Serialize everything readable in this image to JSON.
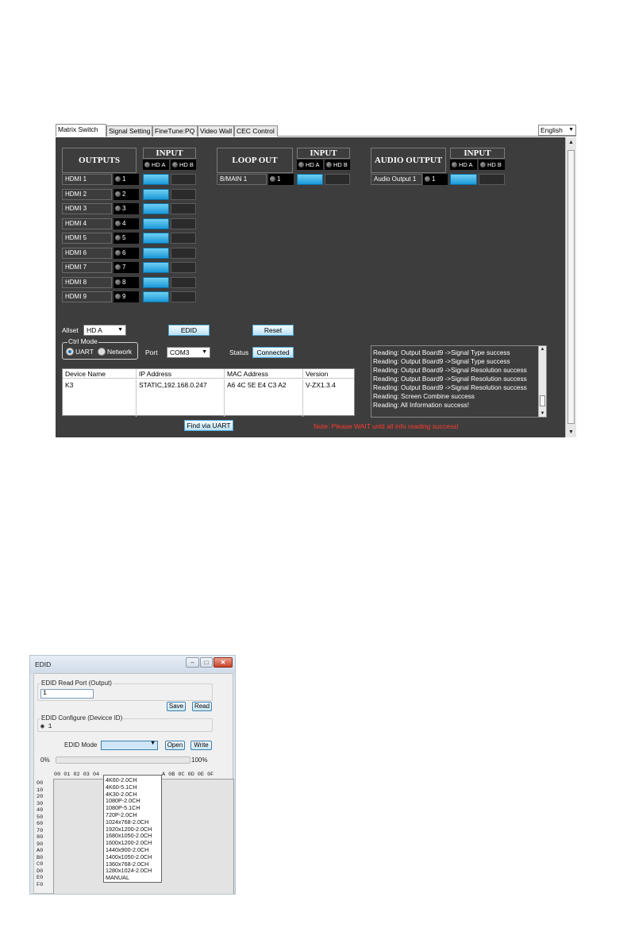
{
  "matrix": {
    "tabs": [
      "Matrix Switch",
      "Signal Setting",
      "FineTune:PQ",
      "Video Wall",
      "CEC Control"
    ],
    "language": "English",
    "outputs_title": "OUTPUTS",
    "input_title": "INPUT",
    "hd_a": "HD A",
    "hd_b": "HD B",
    "loop_out_title": "LOOP OUT",
    "audio_output_title": "AUDIO OUTPUT",
    "outputs": [
      {
        "label": "HDMI 1",
        "num": "1",
        "selected": "HD A"
      },
      {
        "label": "HDMI 2",
        "num": "2",
        "selected": "HD A"
      },
      {
        "label": "HDMI 3",
        "num": "3",
        "selected": "HD A"
      },
      {
        "label": "HDMI 4",
        "num": "4",
        "selected": "HD A"
      },
      {
        "label": "HDMI 5",
        "num": "5",
        "selected": "HD A"
      },
      {
        "label": "HDMI 6",
        "num": "6",
        "selected": "HD A"
      },
      {
        "label": "HDMI 7",
        "num": "7",
        "selected": "HD A"
      },
      {
        "label": "HDMI 8",
        "num": "8",
        "selected": "HD A"
      },
      {
        "label": "HDMI 9",
        "num": "9",
        "selected": "HD A"
      }
    ],
    "loop_out": {
      "label": "B/MAIN 1",
      "num": "1",
      "selected": "HD A"
    },
    "audio_output": {
      "label": "Audio Output 1",
      "num": "1",
      "selected": "HD A"
    },
    "allset_label": "Allset",
    "allset_value": "HD A",
    "edid_button": "EDID",
    "reset_button": "Reset",
    "ctrl_mode_label": "Ctrl Mode",
    "uart_label": "UART",
    "network_label": "Network",
    "port_label": "Port",
    "port_value": "COM3",
    "status_label": "Status",
    "status_value": "Connected",
    "table": {
      "headers": [
        "Device Name",
        "IP Address",
        "MAC Address",
        "Version"
      ],
      "rows": [
        [
          "K3",
          "STATIC,192.168.0.247",
          "A6 4C 5E E4 C3 A2",
          "V-ZX1.3.4"
        ]
      ]
    },
    "log_lines": [
      "Reading: Output Board9 ->Signal Type success",
      "Reading: Output Board9 ->Signal Type success",
      "Reading: Output Board9 ->Signal Resolution success",
      "Reading: Output Board9 ->Signal Resolution success",
      "Reading: Output Board9 ->Signal Resolution success",
      "Reading: Screen Combine success",
      "Reading: All Information success!"
    ],
    "find_button": "Find via UART",
    "note": "Note: Please WAIT until all info reading success!"
  },
  "edid": {
    "title": "EDID",
    "read_port_title": "EDID Read Port (Output)",
    "read_port_value": "1",
    "save_button": "Save",
    "read_button": "Read",
    "configure_title": "EDID Configure (Devicce ID)",
    "configure_value": "1",
    "mode_label": "EDID Mode",
    "open_button": "Open",
    "write_button": "Write",
    "progress_min": "0%",
    "progress_max": "100%",
    "progress": 0,
    "hex_header_left": "00 01 02 03 04",
    "hex_header_right": "A 0B 0C 0D 0E 0F",
    "row_headers": [
      "00",
      "10",
      "20",
      "30",
      "40",
      "50",
      "60",
      "70",
      "80",
      "90",
      "A0",
      "B0",
      "C0",
      "D0",
      "E0",
      "F0"
    ],
    "mode_options": [
      "4K60-2.0CH",
      "4K60-5.1CH",
      "4K30-2.0CH",
      "1080P-2.0CH",
      "1080P-5.1CH",
      "720P-2.0CH",
      "1024x768-2.0CH",
      "1920x1200-2.0CH",
      "1680x1050-2.0CH",
      "1600x1200-2.0CH",
      "1440x900-2.0CH",
      "1400x1050-2.0CH",
      "1360x768-2.0CH",
      "1280x1024-2.0CH",
      "MANUAL"
    ]
  },
  "colors": {
    "panel_bg": "#3d3d3d",
    "route_active": "#1a98d8",
    "note_red": "#ff3b2f",
    "close_red": "#c8442c"
  }
}
